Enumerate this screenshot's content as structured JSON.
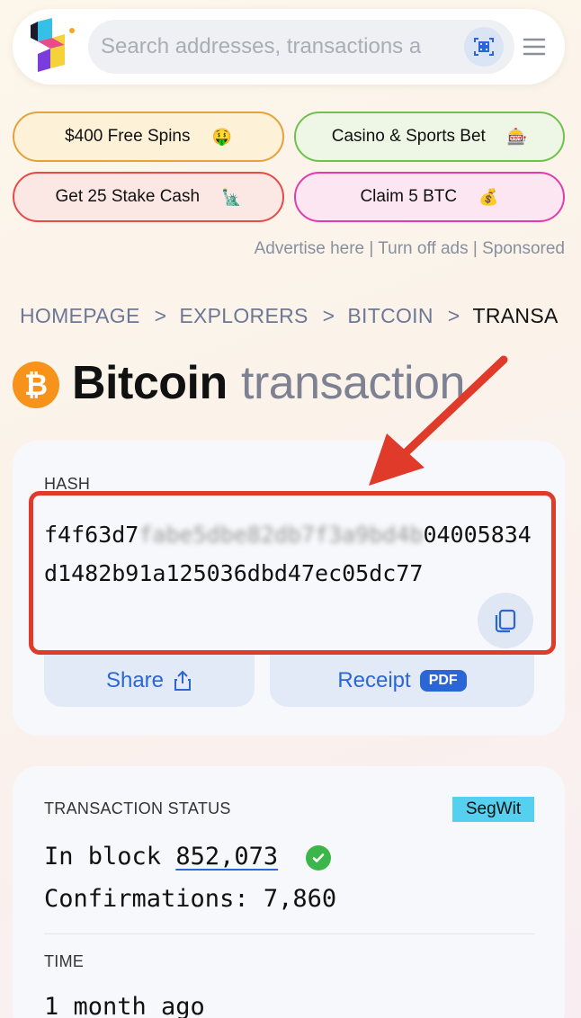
{
  "header": {
    "search_placeholder": "Search addresses, transactions a"
  },
  "ads": {
    "pills": [
      {
        "label": "$400 Free Spins",
        "emoji": "🤑"
      },
      {
        "label": "Casino & Sports Bet",
        "emoji": "🎰"
      },
      {
        "label": "Get 25 Stake Cash",
        "emoji": "🗽"
      },
      {
        "label": "Claim 5 BTC",
        "emoji": "💰"
      }
    ],
    "links": "Advertise here | Turn off ads | Sponsored"
  },
  "breadcrumb": {
    "items": [
      "HOMEPAGE",
      "EXPLORERS",
      "BITCOIN"
    ],
    "current": "TRANSA",
    "separator": ">"
  },
  "title": {
    "main": "Bitcoin",
    "sub": "transaction",
    "coin_symbol": "₿"
  },
  "hash_card": {
    "label": "HASH",
    "hash_visible_start": "f4f63d7",
    "hash_blurred": "fabe5dbe82db7f3a9bd4b",
    "hash_visible_mid": "040",
    "hash_line2": "05834d1482b91a125036dbd47ec05dc",
    "hash_line3": "77",
    "share_label": "Share",
    "receipt_label": "Receipt",
    "pdf_badge": "PDF"
  },
  "status_card": {
    "label": "TRANSACTION STATUS",
    "badge": "SegWit",
    "in_block_prefix": "In block ",
    "block_number": "852,073",
    "confirmations": "Confirmations: 7,860",
    "time_label": "TIME",
    "time_value": "1 month ago"
  },
  "colors": {
    "accent_blue": "#2b66d6",
    "highlight_red": "#e03a2a",
    "bitcoin_orange": "#f7931a",
    "segwit_cyan": "#56d0ef",
    "success_green": "#3cb54a"
  }
}
